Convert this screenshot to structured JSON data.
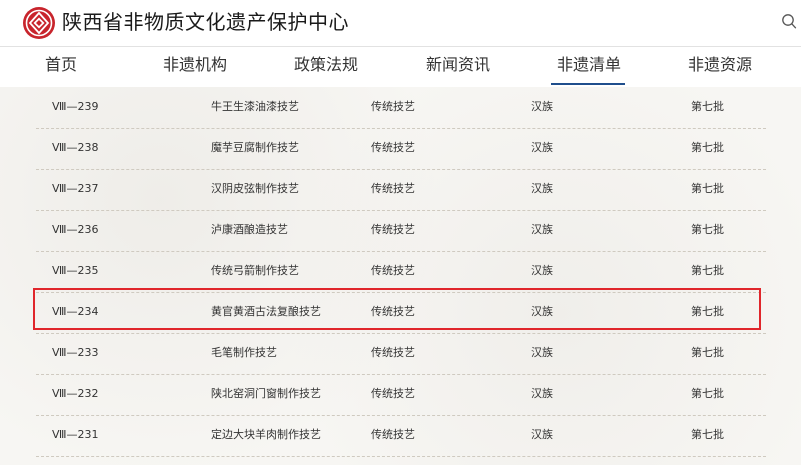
{
  "header": {
    "site_title": "陕西省非物质文化遗产保护中心",
    "logo_icon": "org-emblem-icon",
    "search_icon": "search-icon",
    "brand_color": "#c8242c"
  },
  "nav": {
    "items": [
      {
        "label": "首页"
      },
      {
        "label": "非遗机构"
      },
      {
        "label": "政策法规"
      },
      {
        "label": "新闻资讯"
      },
      {
        "label": "非遗清单"
      },
      {
        "label": "非遗资源"
      }
    ],
    "active_index": 4,
    "active_color": "#1f4e8c"
  },
  "list": {
    "highlight_color": "#e0262b",
    "highlighted_code": "Ⅷ—234",
    "rows": [
      {
        "code": "Ⅷ—239",
        "name": "牛王生漆油漆技艺",
        "category": "传统技艺",
        "ethnicity": "汉族",
        "batch": "第七批"
      },
      {
        "code": "Ⅷ—238",
        "name": "魔芋豆腐制作技艺",
        "category": "传统技艺",
        "ethnicity": "汉族",
        "batch": "第七批"
      },
      {
        "code": "Ⅷ—237",
        "name": "汉阴皮弦制作技艺",
        "category": "传统技艺",
        "ethnicity": "汉族",
        "batch": "第七批"
      },
      {
        "code": "Ⅷ—236",
        "name": "泸康酒酿造技艺",
        "category": "传统技艺",
        "ethnicity": "汉族",
        "batch": "第七批"
      },
      {
        "code": "Ⅷ—235",
        "name": "传统弓箭制作技艺",
        "category": "传统技艺",
        "ethnicity": "汉族",
        "batch": "第七批"
      },
      {
        "code": "Ⅷ—234",
        "name": "黄官黄酒古法复酿技艺",
        "category": "传统技艺",
        "ethnicity": "汉族",
        "batch": "第七批"
      },
      {
        "code": "Ⅷ—233",
        "name": "毛笔制作技艺",
        "category": "传统技艺",
        "ethnicity": "汉族",
        "batch": "第七批"
      },
      {
        "code": "Ⅷ—232",
        "name": "陕北窑洞门窗制作技艺",
        "category": "传统技艺",
        "ethnicity": "汉族",
        "batch": "第七批"
      },
      {
        "code": "Ⅷ—231",
        "name": "定边大块羊肉制作技艺",
        "category": "传统技艺",
        "ethnicity": "汉族",
        "batch": "第七批"
      }
    ]
  }
}
